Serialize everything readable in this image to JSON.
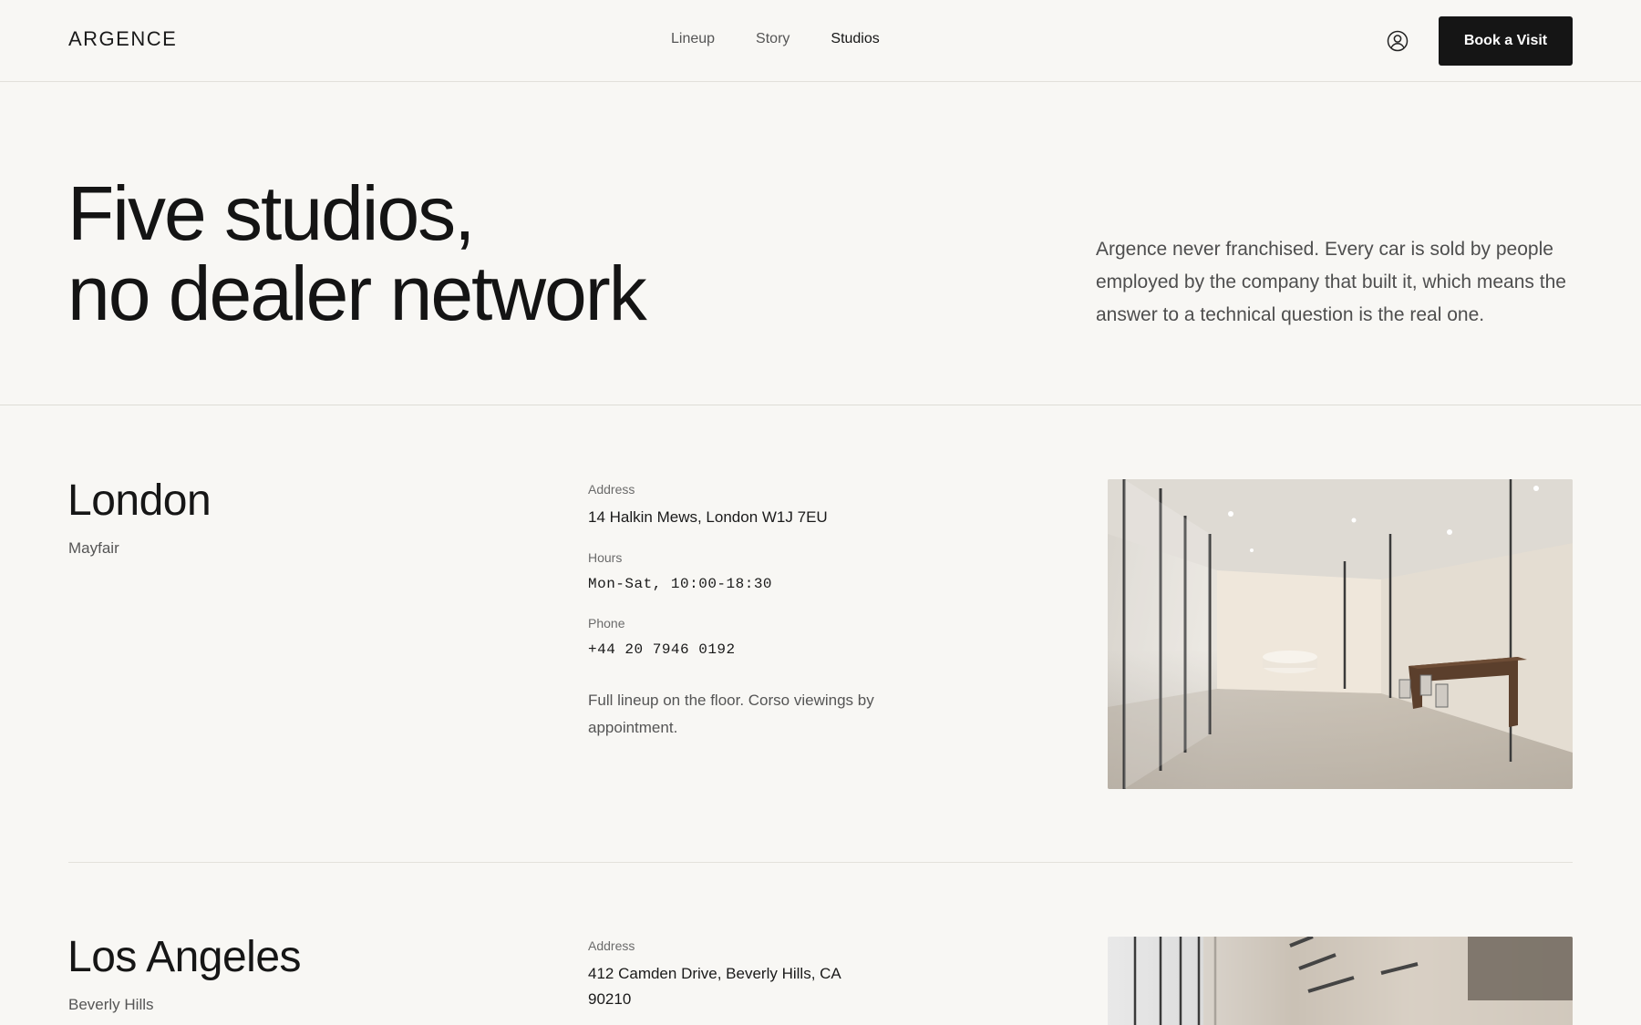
{
  "header": {
    "logo": "ARGENCE",
    "nav": [
      {
        "label": "Lineup",
        "active": false
      },
      {
        "label": "Story",
        "active": false
      },
      {
        "label": "Studios",
        "active": true
      }
    ],
    "account_icon": "user-circle-icon",
    "cta_label": "Book a Visit"
  },
  "hero": {
    "title_line1": "Five studios,",
    "title_line2": "no dealer network",
    "description": "Argence never franchised. Every car is sold by people employed by the company that built it, which means the answer to a technical question is the real one."
  },
  "studios": [
    {
      "city": "London",
      "area": "Mayfair",
      "address_label": "Address",
      "address": "14 Halkin Mews, London W1J 7EU",
      "hours_label": "Hours",
      "hours": "Mon-Sat, 10:00-18:30",
      "phone_label": "Phone",
      "phone": "+44 20 7946 0192",
      "note": "Full lineup on the floor. Corso viewings by appointment."
    },
    {
      "city": "Los Angeles",
      "area": "Beverly Hills",
      "address_label": "Address",
      "address": "412 Camden Drive, Beverly Hills, CA 90210"
    }
  ],
  "colors": {
    "background": "#f8f7f4",
    "text": "#161616",
    "button": "#151515",
    "divider": "#dedcd6"
  }
}
